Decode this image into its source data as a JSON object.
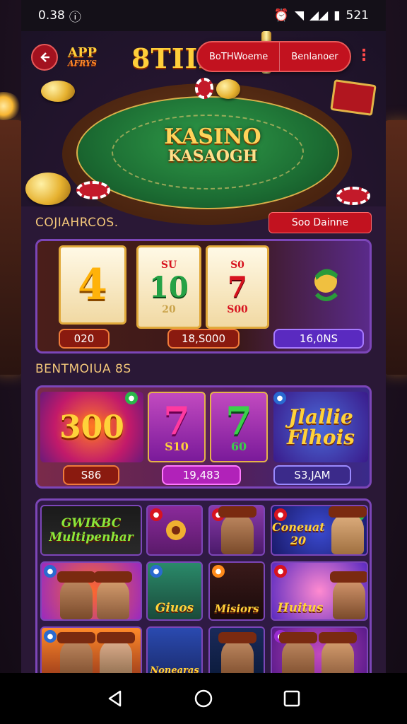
{
  "status": {
    "time": "0.38",
    "battery": "521"
  },
  "hero": {
    "logo_main": "APP",
    "logo_sub": "AFRYS",
    "brand": "8TIIIW",
    "table_title_1": "KASINO",
    "table_title_2": "KASAOGH",
    "nav_segments": [
      "BoTHWoeme",
      "Benlanoer"
    ]
  },
  "section1": {
    "title": "COJIAHRCOS.",
    "action": "Soo Dainne",
    "reels": [
      {
        "top": "",
        "main": "4",
        "bottom": ""
      },
      {
        "top": "SU",
        "main": "10",
        "bottom": "20"
      },
      {
        "top": "S0",
        "main": "7",
        "bottom": "S00"
      }
    ],
    "labels": [
      "020",
      "18,S000",
      "16,0NS"
    ]
  },
  "section2": {
    "title": "BENTMOIUA 8S",
    "tiles": [
      {
        "main": "300",
        "sub": ""
      },
      {
        "main": "7",
        "sub": "S10"
      },
      {
        "main": "7",
        "sub": "60"
      },
      {
        "main": "Jlallie Flhois",
        "sub": ""
      }
    ],
    "labels": [
      "S86",
      "19,483",
      "S3,JAM"
    ]
  },
  "section3": {
    "tiles": [
      "GWIKBC Multipenhar",
      "",
      "",
      "Coneuat 20",
      "",
      "",
      "Giuos",
      "Misiors",
      "Huitus",
      "",
      "Nonearas",
      "",
      ""
    ]
  },
  "colors": {
    "accent_red": "#c2121f",
    "accent_purple": "#7c46b8",
    "gold": "#ffd23a"
  }
}
